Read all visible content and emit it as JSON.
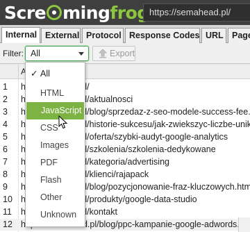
{
  "header": {
    "logo_text": "Screamingfrog",
    "logo_parts": {
      "a": "Scre",
      "b": "",
      "c": "ming",
      "d": "frog"
    },
    "url": "https://semahead.pl/",
    "brand_green": "#8dc63f",
    "bar_color": "#3f3f3f"
  },
  "tabs": [
    {
      "label": "Internal",
      "active": true
    },
    {
      "label": "External",
      "active": false
    },
    {
      "label": "Protocol",
      "active": false
    },
    {
      "label": "Response Codes",
      "active": false
    },
    {
      "label": "URL",
      "active": false
    },
    {
      "label": "Page",
      "active": false
    }
  ],
  "filter": {
    "label": "Filter:",
    "selected": "All",
    "export_label": "Export",
    "options": [
      {
        "label": "All",
        "checked": true,
        "hover": false
      },
      {
        "label": "HTML",
        "checked": false,
        "hover": false
      },
      {
        "label": "JavaScript",
        "checked": false,
        "hover": true
      },
      {
        "label": "CSS",
        "checked": false,
        "hover": false
      },
      {
        "label": "Images",
        "checked": false,
        "hover": false
      },
      {
        "label": "PDF",
        "checked": false,
        "hover": false
      },
      {
        "label": "Flash",
        "checked": false,
        "hover": false
      },
      {
        "label": "Other",
        "checked": false,
        "hover": false
      },
      {
        "label": "Unknown",
        "checked": false,
        "hover": false
      }
    ],
    "hover_color": "#7cb342"
  },
  "grid": {
    "header_address": "A",
    "rows": [
      {
        "num": "1",
        "address": "h",
        "visible_suffix": ".pl/"
      },
      {
        "num": "2",
        "address": "h",
        "visible_suffix": ".pl/aktualnosci"
      },
      {
        "num": "3",
        "address": "h",
        "visible_suffix": ".pl/blog/sprzedaz-z-seo-modele-success-fee."
      },
      {
        "num": "4",
        "address": "h",
        "visible_suffix": ".pl/historie-sukcesu/jak-zwiekszyc-liczbe-unik"
      },
      {
        "num": "5",
        "address": "h",
        "visible_suffix": ".pl/oferta/szybki-audyt-google-analytics"
      },
      {
        "num": "6",
        "address": "h",
        "visible_suffix": ".pl/szkolenia/szkolenia-dedykowane"
      },
      {
        "num": "7",
        "address": "h",
        "visible_suffix": ".pl/kategoria/advertising"
      },
      {
        "num": "8",
        "address": "h",
        "visible_suffix": ".pl/klienci/rajapack"
      },
      {
        "num": "9",
        "address": "h",
        "visible_suffix": ".pl/blog/pozycjonowanie-fraz-kluczowych.htm"
      },
      {
        "num": "10",
        "address": "h",
        "visible_suffix": ".pl/produkty/google-data-studio"
      },
      {
        "num": "11",
        "address": "h",
        "visible_suffix": ".pl/kontakt"
      },
      {
        "num": "12",
        "address": "https://semahead.pl/blog/ppc-kampanie-google-adwords.html",
        "visible_suffix": ""
      }
    ]
  }
}
